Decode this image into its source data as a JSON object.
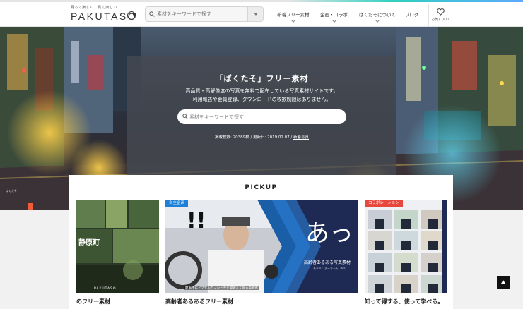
{
  "header": {
    "logo_tagline": "見って楽しい、見て楽しい",
    "logo_word": "PAKUTASO",
    "search_placeholder": "素材をキーワードで探す",
    "nav": [
      {
        "label": "新着フリー素材",
        "has_dropdown": true
      },
      {
        "label": "企画・コラボ",
        "has_dropdown": true
      },
      {
        "label": "ぱくたそについて",
        "has_dropdown": true
      },
      {
        "label": "ブログ",
        "has_dropdown": false
      }
    ],
    "favorites_label": "お気に入り"
  },
  "hero": {
    "title": "「ぱくたそ」フリー素材",
    "line1": "高品質・高解像度の写真を無料で配布している写真素材サイトです。",
    "line2": "利用報告や会員登録、ダウンロードの枚数制限はありません。",
    "search_placeholder": "素材をキーワードで探す",
    "meta_text": "掲載枚数: 20389枚 / 更新日: 2019.01.07 / ",
    "meta_link": "新着写真"
  },
  "pickup": {
    "heading": "PICKUP",
    "cards": [
      {
        "caption": "のフリー素材",
        "badge": "",
        "overlay": "静原町",
        "brand": "PAKUTASO"
      },
      {
        "caption": "高齢者あるあるフリー素材",
        "badge": "自主企画",
        "overlay_big": "あっ",
        "overlay_sub": "高齢者あるある写真素材",
        "overlay_model": "モデル：まーちゃん（90）",
        "overlay_note": "駐車中にアクセルとブレーキを間違えて焦る高齢者"
      },
      {
        "caption": "知って得する、使って学べる。",
        "badge": "コラボレーション"
      }
    ]
  },
  "colors": {
    "accent_blue": "#1d7fd6",
    "badge_red": "#e8473e",
    "navy": "#1e2a53"
  }
}
